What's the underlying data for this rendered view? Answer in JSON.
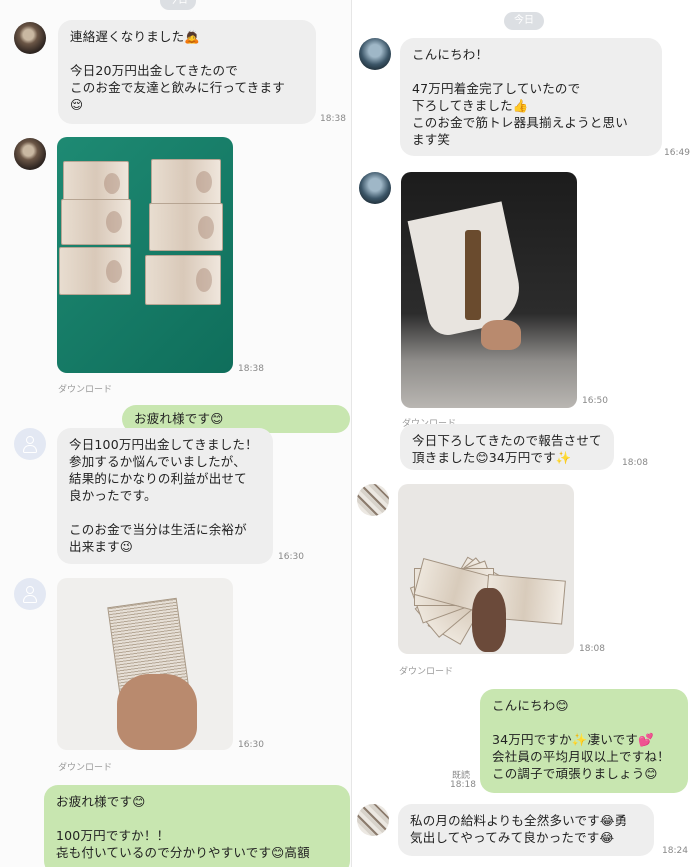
{
  "left_chat": {
    "date_pill": "今日",
    "messages": [
      {
        "text": "連絡遅くなりました🙇\n\n今日20万円出金してきたので\nこのお金で友達と飲みに行ってきます\n😌",
        "time": "18:38"
      },
      {
        "photo_time": "18:38",
        "download": "ダウンロード"
      },
      {
        "text": "お疲れ様です😊"
      },
      {
        "text": "今日100万円出金してきました！\n参加するか悩んでいましたが、\n結果的にかなりの利益が出せて\n良かったです。\n\nこのお金で当分は生活に余裕が\n出来ます😉",
        "time": "16:30"
      },
      {
        "photo_time": "16:30",
        "download": "ダウンロード"
      },
      {
        "text": "お疲れ様です😊\n\n100万円ですか！！\n㐂も付いているので分かりやすいです😊高額"
      }
    ]
  },
  "right_chat": {
    "date_pill": "今日",
    "messages": [
      {
        "text": "こんにちわ！\n\n47万円着金完了していたので\n下ろしてきました👍\nこのお金で筋トレ器具揃えようと思い\nます笑",
        "time": "16:49"
      },
      {
        "photo_time": "16:50",
        "download": "ダウンロード"
      },
      {
        "text": "今日下ろしてきたので報告させて\n頂きました😊34万円です✨",
        "time": "18:08"
      },
      {
        "photo_time": "18:08",
        "download": "ダウンロード"
      },
      {
        "text": "こんにちわ😊\n\n34万円ですか✨凄いです💕\n会社員の平均月収以上ですね！\nこの調子で頑張りましょう😊",
        "read": "既読",
        "time": "18:18"
      },
      {
        "text": "私の月の給料よりも全然多いです😂勇\n気出してやってみて良かったです😂",
        "time": "18:24"
      }
    ]
  },
  "colors": {
    "incoming_bubble": "#eeeeee",
    "outgoing_bubble": "#c8e6b0",
    "date_pill": "#dcdfe3"
  },
  "icons": [
    "default-user-avatar-icon"
  ]
}
